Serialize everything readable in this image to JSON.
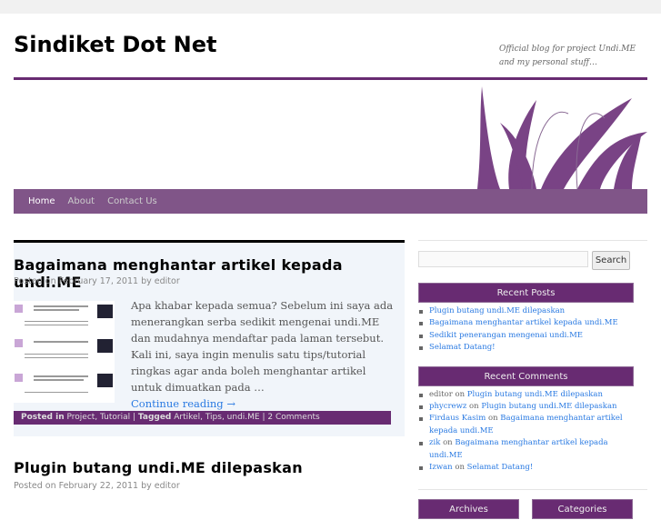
{
  "site": {
    "title": "Sindiket Dot Net",
    "tagline": "Official blog for project Undi.ME and my personal stuff…"
  },
  "nav": [
    {
      "label": "Home"
    },
    {
      "label": "About"
    },
    {
      "label": "Contact Us"
    }
  ],
  "posts": [
    {
      "title": "Bagaimana menghantar artikel kepada undi.ME",
      "posted_on": "Posted on",
      "date": "February 17, 2011",
      "by": "by",
      "author": "editor",
      "excerpt": "Apa khabar kepada semua? Sebelum ini saya ada menerangkan serba sedikit mengenai undi.ME dan mudahnya mendaftar pada laman tersebut. Kali ini, saya ingin menulis satu tips/tutorial ringkas agar anda boleh menghantar artikel untuk dimuatkan pada …",
      "continue": "Continue reading →",
      "posted_in": "Posted in",
      "categories": [
        "Project",
        "Tutorial"
      ],
      "tagged": "Tagged",
      "tags": [
        "Artikel",
        "Tips",
        "undi.ME"
      ],
      "comments": "2 Comments"
    },
    {
      "title": "Plugin butang undi.ME dilepaskan",
      "posted_on": "Posted on",
      "date": "February 22, 2011",
      "by": "by",
      "author": "editor"
    }
  ],
  "sidebar": {
    "search_button": "Search",
    "search_value": "",
    "recent_posts_title": "Recent Posts",
    "recent_posts": [
      "Plugin butang undi.ME dilepaskan",
      "Bagaimana menghantar artikel kepada undi.ME",
      "Sedikit penerangan mengenai undi.ME",
      "Selamat Datang!"
    ],
    "recent_comments_title": "Recent Comments",
    "recent_comments": [
      {
        "author": "editor",
        "on": "on",
        "post": "Plugin butang undi.ME dilepaskan",
        "linked": false
      },
      {
        "author": "phycrewz",
        "on": "on",
        "post": "Plugin butang undi.ME dilepaskan",
        "linked": true
      },
      {
        "author": "Firdaus Kasim",
        "on": "on",
        "post": "Bagaimana menghantar artikel kepada undi.ME",
        "linked": true
      },
      {
        "author": "zik",
        "on": "on",
        "post": "Bagaimana menghantar artikel kepada undi.ME",
        "linked": true
      },
      {
        "author": "Izwan",
        "on": "on",
        "post": "Selamat Datang!",
        "linked": true
      }
    ],
    "archives_title": "Archives",
    "categories_title": "Categories"
  },
  "colors": {
    "brand": "#682b72",
    "link": "#2a7ae2"
  }
}
